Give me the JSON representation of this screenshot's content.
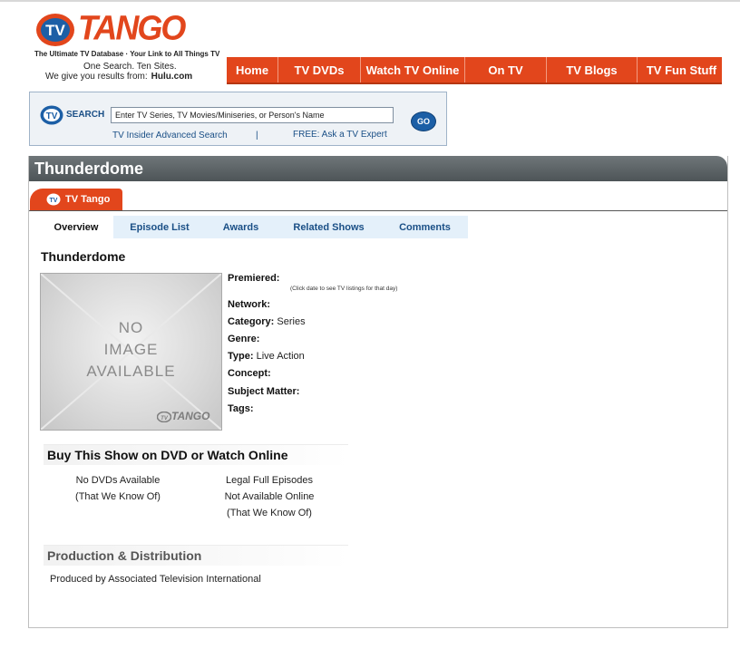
{
  "header": {
    "logo_text": "TANGO",
    "logo_badge": "TV",
    "tagline": "The Ultimate TV Database · Your Link to All Things TV",
    "one_search": "One Search. Ten Sites.",
    "results_prefix": "We give you results from:",
    "results_site": "Hulu.com"
  },
  "nav": {
    "items": [
      "Home",
      "TV DVDs",
      "Watch TV Online",
      "On TV",
      "TV Blogs",
      "TV Fun Stuff"
    ]
  },
  "search": {
    "label": "SEARCH",
    "placeholder": "Enter TV Series, TV Movies/Miniseries, or Person's Name",
    "go_label": "GO",
    "advanced_link": "TV Insider Advanced Search",
    "separator": "|",
    "ask_link": "FREE: Ask a TV Expert"
  },
  "show": {
    "header_title": "Thunderdome",
    "source_tab": "TV Tango",
    "tabs": [
      "Overview",
      "Episode List",
      "Awards",
      "Related Shows",
      "Comments"
    ],
    "title": "Thunderdome",
    "no_image": {
      "line1": "NO",
      "line2": "IMAGE",
      "line3": "AVAILABLE",
      "logo": "TANGO"
    },
    "details": {
      "premiered_label": "Premiered:",
      "premiered_note": "(Click date to see TV listings for that day)",
      "network_label": "Network:",
      "category_label": "Category:",
      "category_value": "Series",
      "genre_label": "Genre:",
      "type_label": "Type:",
      "type_value": "Live Action",
      "concept_label": "Concept:",
      "subject_label": "Subject Matter:",
      "tags_label": "Tags:"
    }
  },
  "buy": {
    "heading": "Buy This Show on DVD or Watch Online",
    "dvd_line1": "No DVDs Available",
    "dvd_line2": "(That We Know Of)",
    "online_line1": "Legal Full Episodes",
    "online_line2": "Not Available Online",
    "online_line3": "(That We Know Of)"
  },
  "production": {
    "heading": "Production & Distribution",
    "produced_by": "Produced by Associated Television International"
  },
  "colors": {
    "brand_orange": "#e2461c",
    "link_blue": "#1a4f86",
    "header_gray": "#5e6568"
  }
}
